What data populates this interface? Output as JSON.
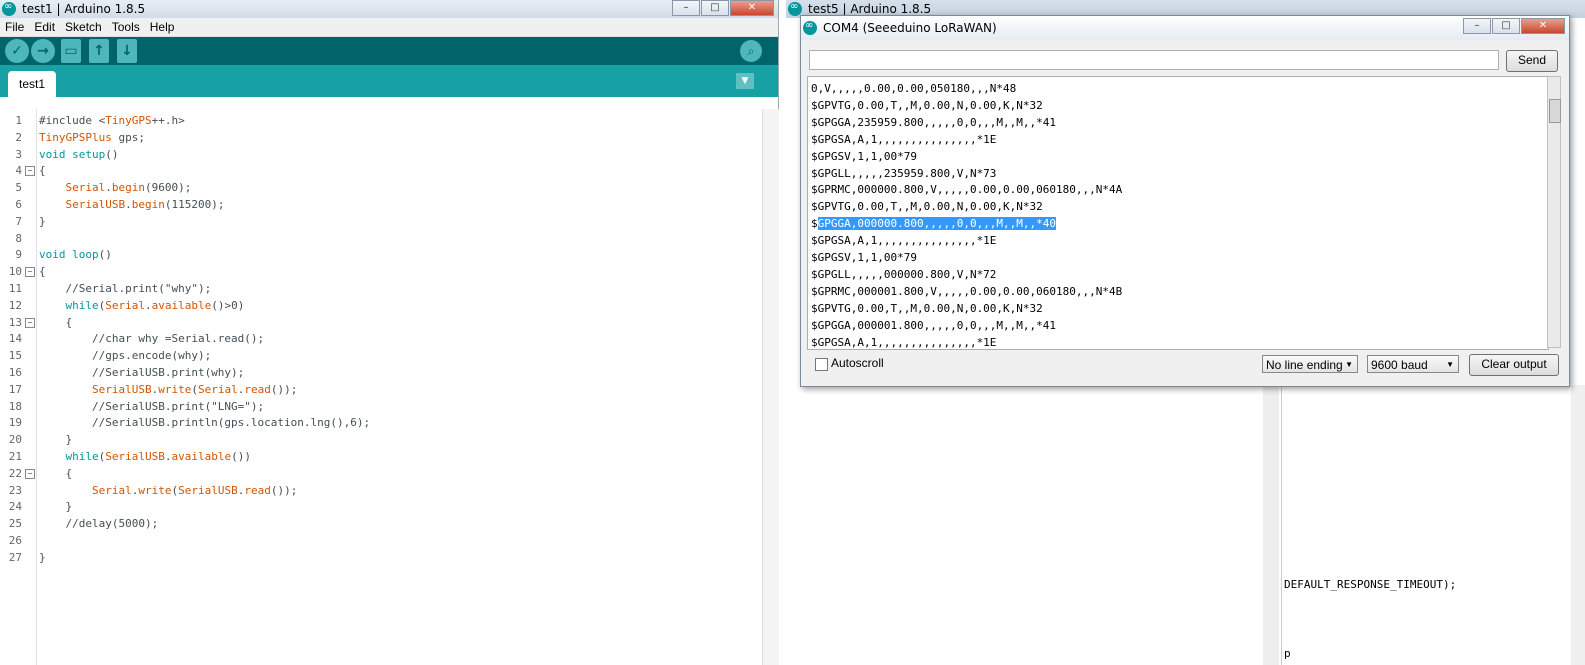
{
  "ide": {
    "title": "test1 | Arduino 1.8.5",
    "menu": [
      "File",
      "Edit",
      "Sketch",
      "Tools",
      "Help"
    ],
    "tab_label": "test1",
    "toolbar_icons": [
      "verify-icon",
      "upload-icon",
      "new-icon",
      "open-icon",
      "save-icon"
    ],
    "serial_monitor_icon": "magnifier-icon",
    "tab_menu_glyph": "▼",
    "code_lines": [
      {
        "n": "1",
        "text": "#include <TinyGPS++.h>"
      },
      {
        "n": "2",
        "text": "TinyGPSPlus gps;"
      },
      {
        "n": "3",
        "text": "void setup()"
      },
      {
        "n": "4",
        "text": "{",
        "fold": "−"
      },
      {
        "n": "5",
        "text": "    Serial.begin(9600);"
      },
      {
        "n": "6",
        "text": "    SerialUSB.begin(115200);"
      },
      {
        "n": "7",
        "text": "}"
      },
      {
        "n": "8",
        "text": ""
      },
      {
        "n": "9",
        "text": "void loop()"
      },
      {
        "n": "10",
        "text": "{",
        "fold": "−"
      },
      {
        "n": "11",
        "text": "    //Serial.print(\"why\");"
      },
      {
        "n": "12",
        "text": "    while(Serial.available()>0)"
      },
      {
        "n": "13",
        "text": "    {",
        "fold": "−"
      },
      {
        "n": "14",
        "text": "        //char why =Serial.read();"
      },
      {
        "n": "15",
        "text": "        //gps.encode(why);"
      },
      {
        "n": "16",
        "text": "        //SerialUSB.print(why);"
      },
      {
        "n": "17",
        "text": "        SerialUSB.write(Serial.read());"
      },
      {
        "n": "18",
        "text": "        //SerialUSB.print(\"LNG=\");"
      },
      {
        "n": "19",
        "text": "        //SerialUSB.println(gps.location.lng(),6);"
      },
      {
        "n": "20",
        "text": "    }"
      },
      {
        "n": "21",
        "text": "    while(SerialUSB.available())"
      },
      {
        "n": "22",
        "text": "    {",
        "fold": "−"
      },
      {
        "n": "23",
        "text": "        Serial.write(SerialUSB.read());"
      },
      {
        "n": "24",
        "text": "    }"
      },
      {
        "n": "25",
        "text": "    //delay(5000);"
      },
      {
        "n": "26",
        "text": ""
      },
      {
        "n": "27",
        "text": "}"
      }
    ]
  },
  "second_ide": {
    "title": "test5 | Arduino 1.8.5",
    "visible_code": [
      "DEFAULT_RESPONSE_TIMEOUT);",
      "p"
    ]
  },
  "serial_monitor": {
    "title": "COM4 (Seeeduino LoRaWAN)",
    "input_value": "",
    "send_label": "Send",
    "output_lines": [
      "0,V,,,,,0.00,0.00,050180,,,N*48",
      "$GPVTG,0.00,T,,M,0.00,N,0.00,K,N*32",
      "$GPGGA,235959.800,,,,,0,0,,,M,,M,,*41",
      "$GPGSA,A,1,,,,,,,,,,,,,,,*1E",
      "$GPGSV,1,1,00*79",
      "$GPGLL,,,,,235959.800,V,N*73",
      "$GPRMC,000000.800,V,,,,,0.00,0.00,060180,,,N*4A",
      "$GPVTG,0.00,T,,M,0.00,N,0.00,K,N*32",
      "$GPGGA,000000.800,,,,,0,0,,,M,,M,,*40",
      "$GPGSA,A,1,,,,,,,,,,,,,,,*1E",
      "$GPGSV,1,1,00*79",
      "$GPGLL,,,,,000000.800,V,N*72",
      "$GPRMC,000001.800,V,,,,,0.00,0.00,060180,,,N*4B",
      "$GPVTG,0.00,T,,M,0.00,N,0.00,K,N*32",
      "$GPGGA,000001.800,,,,,0,0,,,M,,M,,*41",
      "$GPGSA,A,1,,,,,,,,,,,,,,,*1E"
    ],
    "highlighted_line_index": 8,
    "autoscroll_label": "Autoscroll",
    "autoscroll_checked": false,
    "line_ending": "No line ending",
    "baud": "9600 baud",
    "clear_label": "Clear output"
  },
  "window_controls": {
    "minimize": "–",
    "maximize": "□",
    "close": "✕"
  },
  "colors": {
    "toolbar": "#006468",
    "tabbar": "#17a1a5",
    "keyword": "#00979c",
    "type": "#d35400",
    "selection": "#3399ff"
  }
}
